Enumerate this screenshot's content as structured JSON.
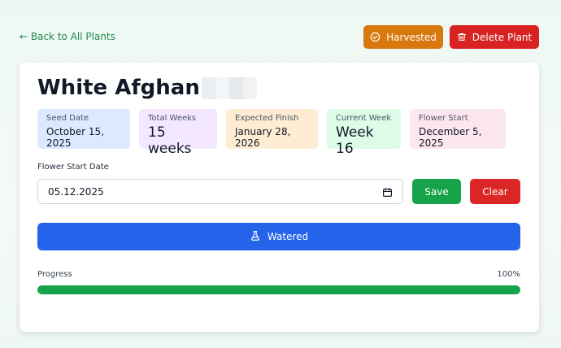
{
  "nav": {
    "back_label": "← Back to All Plants"
  },
  "actions": {
    "harvested_label": "Harvested",
    "delete_label": "Delete Plant"
  },
  "plant": {
    "name": "White Afghan"
  },
  "stats": {
    "seed_date": {
      "label": "Seed Date",
      "value": "October 15, 2025"
    },
    "total_weeks": {
      "label": "Total Weeks",
      "value": "15 weeks"
    },
    "expected_finish": {
      "label": "Expected Finish",
      "value": "January 28, 2026"
    },
    "current_week": {
      "label": "Current Week",
      "value": "Week 16"
    },
    "flower_start": {
      "label": "Flower Start",
      "value": "December 5, 2025"
    }
  },
  "flower_form": {
    "label": "Flower Start Date",
    "value": "05.12.2025",
    "save_label": "Save",
    "clear_label": "Clear"
  },
  "watered": {
    "label": "Watered"
  },
  "progress": {
    "label": "Progress",
    "percent_text": "100%",
    "fraction": 1.0
  },
  "colors": {
    "harvested": "#d9780f",
    "delete": "#d92323",
    "save": "#16a34a",
    "clear": "#dc2626",
    "watered": "#2563eb",
    "progress": "#16a34a"
  },
  "icons": {
    "harvested": "check-circle-icon",
    "delete": "trash-icon",
    "watered": "flask-icon",
    "date": "calendar-icon"
  }
}
